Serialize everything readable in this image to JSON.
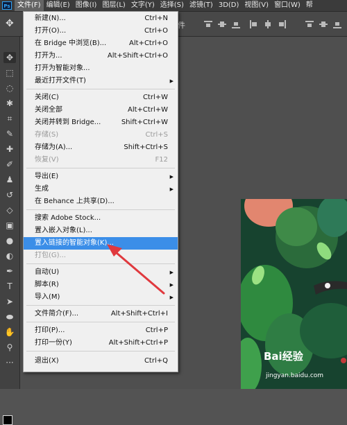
{
  "app": {
    "logo": "Ps"
  },
  "menubar": {
    "items": [
      "文件(F)",
      "编辑(E)",
      "图像(I)",
      "图层(L)",
      "文字(Y)",
      "选择(S)",
      "滤镜(T)",
      "3D(D)",
      "视图(V)",
      "窗口(W)",
      "帮"
    ]
  },
  "options": {
    "move_icon": "move-tool-icon",
    "partial_label": "件"
  },
  "file_menu": {
    "items": [
      {
        "label": "新建(N)...",
        "shortcut": "Ctrl+N"
      },
      {
        "label": "打开(O)...",
        "shortcut": "Ctrl+O"
      },
      {
        "label": "在 Bridge 中浏览(B)...",
        "shortcut": "Alt+Ctrl+O"
      },
      {
        "label": "打开为...",
        "shortcut": "Alt+Shift+Ctrl+O"
      },
      {
        "label": "打开为智能对象...",
        "shortcut": ""
      },
      {
        "label": "最近打开文件(T)",
        "shortcut": "",
        "submenu": true
      },
      {
        "label": "关闭(C)",
        "shortcut": "Ctrl+W"
      },
      {
        "label": "关闭全部",
        "shortcut": "Alt+Ctrl+W"
      },
      {
        "label": "关闭并转到 Bridge...",
        "shortcut": "Shift+Ctrl+W"
      },
      {
        "label": "存储(S)",
        "shortcut": "Ctrl+S",
        "disabled": true
      },
      {
        "label": "存储为(A)...",
        "shortcut": "Shift+Ctrl+S"
      },
      {
        "label": "恢复(V)",
        "shortcut": "F12",
        "disabled": true
      },
      {
        "label": "导出(E)",
        "shortcut": "",
        "submenu": true
      },
      {
        "label": "生成",
        "shortcut": "",
        "submenu": true
      },
      {
        "label": "在 Behance 上共享(D)...",
        "shortcut": ""
      },
      {
        "label": "搜索 Adobe Stock...",
        "shortcut": ""
      },
      {
        "label": "置入嵌入对象(L)...",
        "shortcut": ""
      },
      {
        "label": "置入链接的智能对象(K)...",
        "shortcut": "",
        "highlighted": true
      },
      {
        "label": "打包(G)...",
        "shortcut": "",
        "disabled": true
      },
      {
        "label": "自动(U)",
        "shortcut": "",
        "submenu": true
      },
      {
        "label": "脚本(R)",
        "shortcut": "",
        "submenu": true
      },
      {
        "label": "导入(M)",
        "shortcut": "",
        "submenu": true
      },
      {
        "label": "文件简介(F)...",
        "shortcut": "Alt+Shift+Ctrl+I"
      },
      {
        "label": "打印(P)...",
        "shortcut": "Ctrl+P"
      },
      {
        "label": "打印一份(Y)",
        "shortcut": "Alt+Shift+Ctrl+P"
      },
      {
        "label": "退出(X)",
        "shortcut": "Ctrl+Q"
      }
    ]
  },
  "watermark": {
    "text": "Bai经验",
    "sub": "jingyan.baidu.com"
  },
  "colors": {
    "highlight": "#3b8ee8",
    "annotation_arrow": "#e0393e",
    "menu_bg": "#f0f0f0"
  }
}
